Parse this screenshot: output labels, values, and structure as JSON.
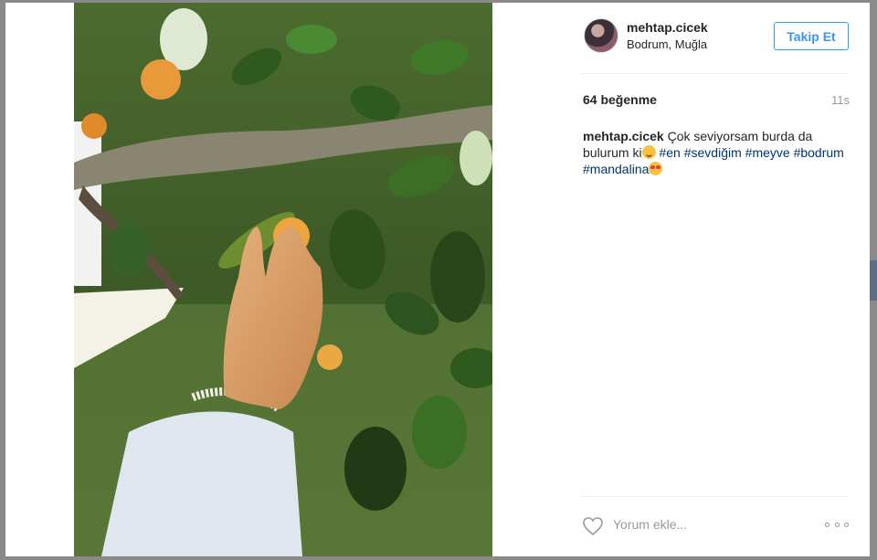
{
  "post": {
    "username": "mehtap.cicek",
    "location": "Bodrum, Muğla",
    "follow_label": "Takip Et",
    "likes": "64 beğenme",
    "time": "11s",
    "caption": {
      "user": "mehtap.cicek",
      "text_part1": "Çok seviyorsam burda da bulurum ki",
      "tags_line1": [
        "#en",
        "#sevdiğim",
        "#meyve"
      ],
      "tags_line2": [
        "#bodrum",
        "#mandalina"
      ],
      "emoji1": "hugging-face-emoji",
      "emoji2": "heart-eyes-emoji"
    },
    "comment": {
      "placeholder": "Yorum ekle..."
    }
  },
  "icons": {
    "like": "heart-outline-icon",
    "more": "more-options-icon"
  },
  "colors": {
    "accent": "#3897f0",
    "hashtag": "#003569",
    "muted": "#999999"
  }
}
